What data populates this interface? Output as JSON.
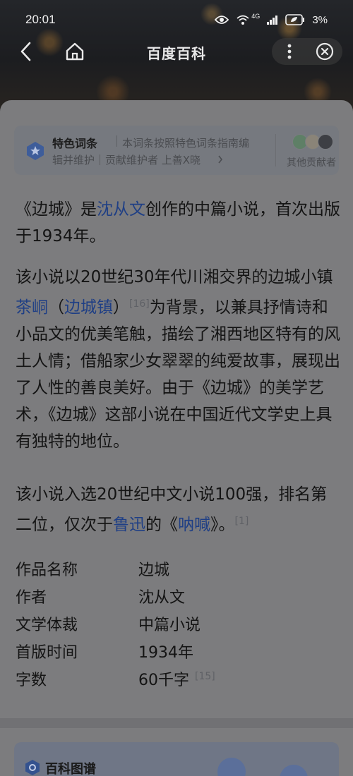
{
  "status_bar": {
    "time": "20:01",
    "network": "4G",
    "battery": "3%"
  },
  "nav": {
    "title": "百度百科"
  },
  "feature": {
    "title": "特色词条",
    "line1": "本词条按照特色词条指南编",
    "line2": "辑并维护｜贡献维护者 上善X晓",
    "contributors_label": "其他贡献者"
  },
  "content": {
    "p1": {
      "open": "《边城》是",
      "author_link": "沈从文",
      "rest": "创作的中篇小说，首次出版于1934年。"
    },
    "p2": {
      "part1": "该小说以20世纪30年代川湘交界的边城小镇",
      "link1": "茶峒",
      "paren_open": "（",
      "link2": "边城镇",
      "paren_close": "）",
      "ref": "[16]",
      "part2": "为背景，以兼具抒情诗和小品文的优美笔触，描绘了湘西地区特有的风土人情；借船家少女翠翠的纯爱故事，展现出了人性的善良美好。由于《边城》的美学艺术，《边城》这部小说在中国近代文学史上具有独特的地位。"
    },
    "p3": {
      "part1": "该小说入选20世纪中文小说100强，排名第二位，仅次于",
      "link1": "鲁迅",
      "part2": "的《",
      "link2": "呐喊",
      "part3": "》。",
      "ref": "[1]"
    }
  },
  "info": {
    "rows": [
      {
        "key": "作品名称",
        "value": "边城"
      },
      {
        "key": "作者",
        "value": "沈从文"
      },
      {
        "key": "文学体裁",
        "value": "中篇小说"
      },
      {
        "key": "首版时间",
        "value": "1934年"
      },
      {
        "key": "字数",
        "value": "60千字",
        "ref": "[15]"
      }
    ]
  },
  "graph": {
    "title": "百科图谱"
  },
  "colors": {
    "link": "#1f3f85",
    "sheet_bg": "#7c7c7e",
    "text": "#141414"
  }
}
